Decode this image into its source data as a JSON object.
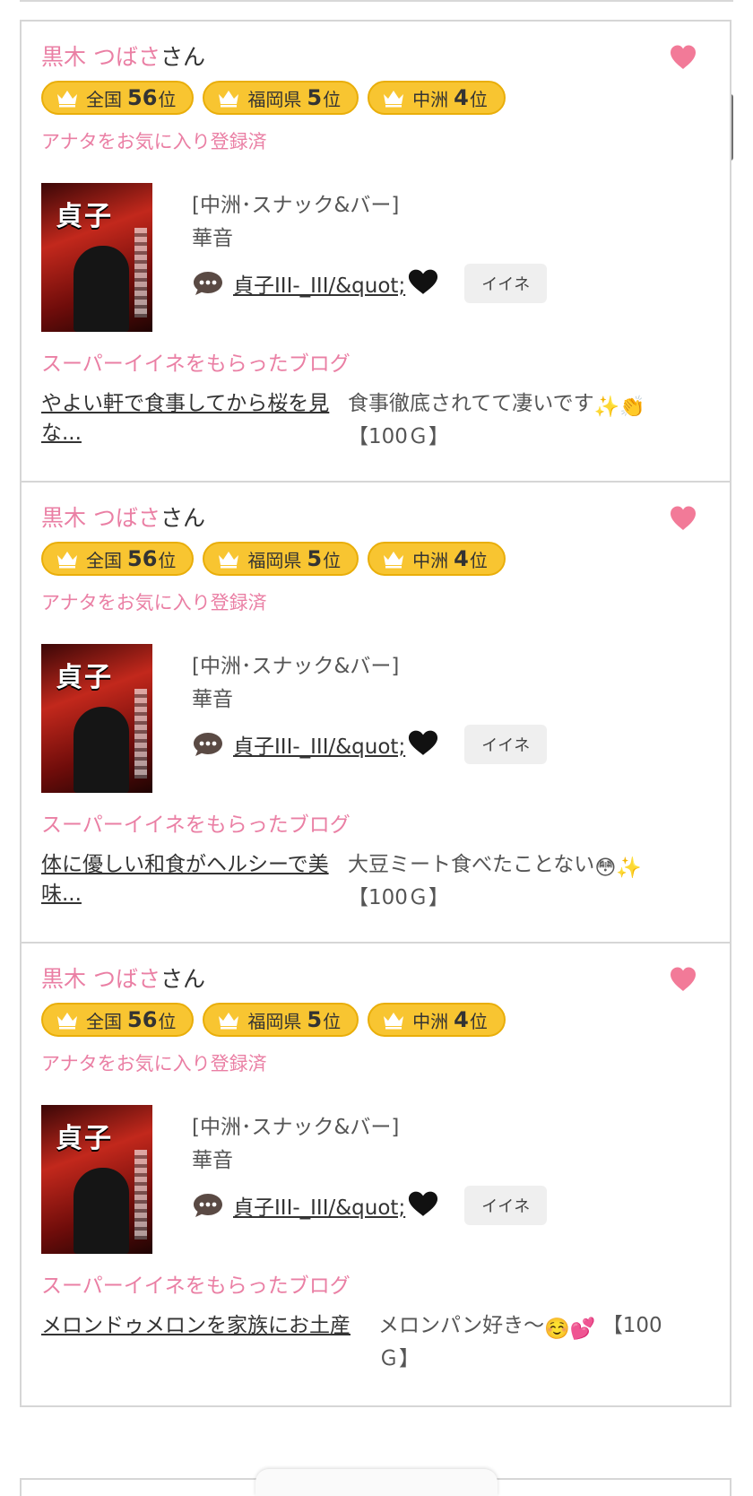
{
  "colors": {
    "pink": "#ea7fa4",
    "badge_gold": "#f8c531",
    "badge_border": "#e9ae0a"
  },
  "icons": {
    "favorite": "heart-icon",
    "rank": "crown-icon",
    "comment": "speech-bubble-icon"
  },
  "cards": [
    {
      "name": "黒木 つばさ",
      "suffix": "さん",
      "badges": [
        {
          "area": "全国",
          "rank": "56",
          "unit": "位"
        },
        {
          "area": "福岡県",
          "rank": "5",
          "unit": "位"
        },
        {
          "area": "中洲",
          "rank": "4",
          "unit": "位"
        }
      ],
      "fav_status": "アナタをお気に入り登録済",
      "image_title": "貞子",
      "shop_category": "[中洲･スナック&バー]",
      "shop_name": "華音",
      "comment": "貞子III-_III/&quot;",
      "like_label": "イイネ",
      "super_label": "スーパーイイネをもらったブログ",
      "blog_title": "やよい軒で食事してから桜を見な...",
      "blog_comment": "食事徹底されてて凄いです",
      "blog_emoji": "✨👏",
      "blog_points": "【100Ｇ】"
    },
    {
      "name": "黒木 つばさ",
      "suffix": "さん",
      "badges": [
        {
          "area": "全国",
          "rank": "56",
          "unit": "位"
        },
        {
          "area": "福岡県",
          "rank": "5",
          "unit": "位"
        },
        {
          "area": "中洲",
          "rank": "4",
          "unit": "位"
        }
      ],
      "fav_status": "アナタをお気に入り登録済",
      "image_title": "貞子",
      "shop_category": "[中洲･スナック&バー]",
      "shop_name": "華音",
      "comment": "貞子III-_III/&quot;",
      "like_label": "イイネ",
      "super_label": "スーパーイイネをもらったブログ",
      "blog_title": "体に優しい和食がヘルシーで美味...",
      "blog_comment": "大豆ミート食べたことない",
      "blog_emoji": "😳✨",
      "blog_points": "【100Ｇ】"
    },
    {
      "name": "黒木 つばさ",
      "suffix": "さん",
      "badges": [
        {
          "area": "全国",
          "rank": "56",
          "unit": "位"
        },
        {
          "area": "福岡県",
          "rank": "5",
          "unit": "位"
        },
        {
          "area": "中洲",
          "rank": "4",
          "unit": "位"
        }
      ],
      "fav_status": "アナタをお気に入り登録済",
      "image_title": "貞子",
      "shop_category": "[中洲･スナック&バー]",
      "shop_name": "華音",
      "comment": "貞子III-_III/&quot;",
      "like_label": "イイネ",
      "super_label": "スーパーイイネをもらったブログ",
      "blog_title": "メロンドゥメロンを家族にお土産",
      "blog_comment": "メロンパン好き〜",
      "blog_emoji": "☺️💕",
      "blog_points": "【100Ｇ】"
    }
  ]
}
